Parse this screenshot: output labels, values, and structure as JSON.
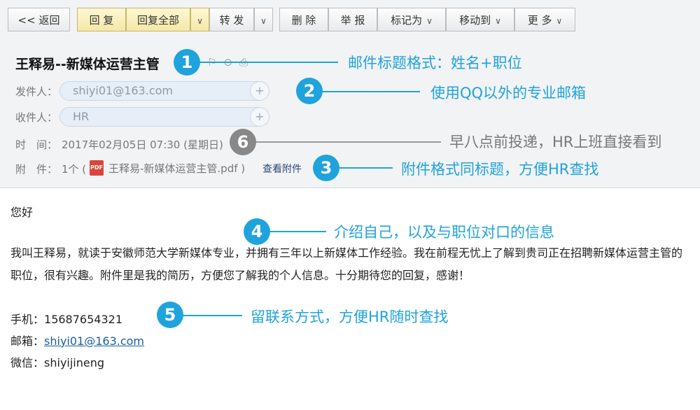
{
  "toolbar": {
    "back": "<< 返回",
    "reply": "回 复",
    "reply_all": "回复全部",
    "forward": "转 发",
    "delete": "删 除",
    "report": "举 报",
    "mark_as": "标记为",
    "move_to": "移动到",
    "more": "更 多"
  },
  "mail": {
    "title": "王释易--新媒体运营主管",
    "from_label": "发件人：",
    "from_value": "shiyi01@163.com",
    "to_label": "收件人：",
    "to_value": "HR",
    "time_label": "时　间：",
    "time_value": "2017年02月05日 07:30 (星期日)",
    "attach_label": "附　件：",
    "attach_count": "1个 (",
    "attach_pdf_icon": "PDF",
    "attach_name": "王释易-新媒体运营主管.pdf )",
    "view_attach": "查看附件"
  },
  "annotations": [
    {
      "num": "1",
      "text": "邮件标题格式：姓名+职位"
    },
    {
      "num": "2",
      "text": "使用QQ以外的专业邮箱"
    },
    {
      "num": "6",
      "text": "早八点前投递，HR上班直接看到"
    },
    {
      "num": "3",
      "text": "附件格式同标题，方便HR查找"
    },
    {
      "num": "4",
      "text": "介绍自己，以及与职位对口的信息"
    },
    {
      "num": "5",
      "text": "留联系方式，方便HR随时查找"
    }
  ],
  "body": {
    "greeting": "您好",
    "para": "我叫王释易，就读于安徽师范大学新媒体专业，并拥有三年以上新媒体工作经验。我在前程无忧上了解到贵司正在招聘新媒体运营主管的职位，很有兴趣。附件里是我的简历，方便您了解我的个人信息。十分期待您的回复，感谢！",
    "phone_label": "手机：",
    "phone": "15687654321",
    "email_label": "邮箱：",
    "email": "shiyi01@163.com",
    "wechat_label": "微信：",
    "wechat": "shiyijineng"
  },
  "colors": {
    "accent": "#1fa3dc",
    "toolbar_yellow": "#f4e7a8"
  }
}
